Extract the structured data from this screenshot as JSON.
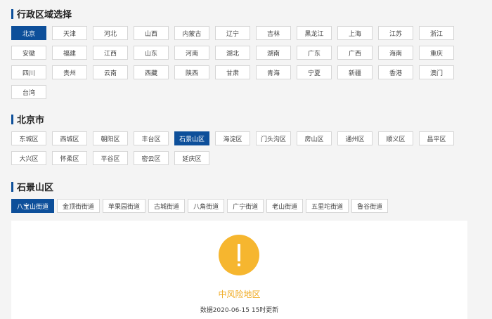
{
  "provinces": {
    "title": "行政区域选择",
    "items": [
      "北京",
      "天津",
      "河北",
      "山西",
      "内蒙古",
      "辽宁",
      "吉林",
      "黑龙江",
      "上海",
      "江苏",
      "浙江",
      "安徽",
      "福建",
      "江西",
      "山东",
      "河南",
      "湖北",
      "湖南",
      "广东",
      "广西",
      "海南",
      "重庆",
      "四川",
      "贵州",
      "云南",
      "西藏",
      "陕西",
      "甘肃",
      "青海",
      "宁夏",
      "新疆",
      "香港",
      "澳门",
      "台湾"
    ],
    "selected": "北京"
  },
  "districts": {
    "title": "北京市",
    "items": [
      "东城区",
      "西城区",
      "朝阳区",
      "丰台区",
      "石景山区",
      "海淀区",
      "门头沟区",
      "房山区",
      "通州区",
      "顺义区",
      "昌平区",
      "大兴区",
      "怀柔区",
      "平谷区",
      "密云区",
      "延庆区"
    ],
    "selected": "石景山区"
  },
  "streets": {
    "title": "石景山区",
    "items": [
      "八宝山街道",
      "金顶街街道",
      "苹果园街道",
      "古城街道",
      "八角街道",
      "广宁街道",
      "老山街道",
      "五里坨街道",
      "鲁谷街道"
    ],
    "selected": "八宝山街道"
  },
  "result": {
    "icon": "exclamation-icon",
    "risk_level": "中风险地区",
    "update_text": "数据2020-06-15 15时更新",
    "accent_color": "#f6b62f",
    "brand_color": "#0d4f9a"
  }
}
